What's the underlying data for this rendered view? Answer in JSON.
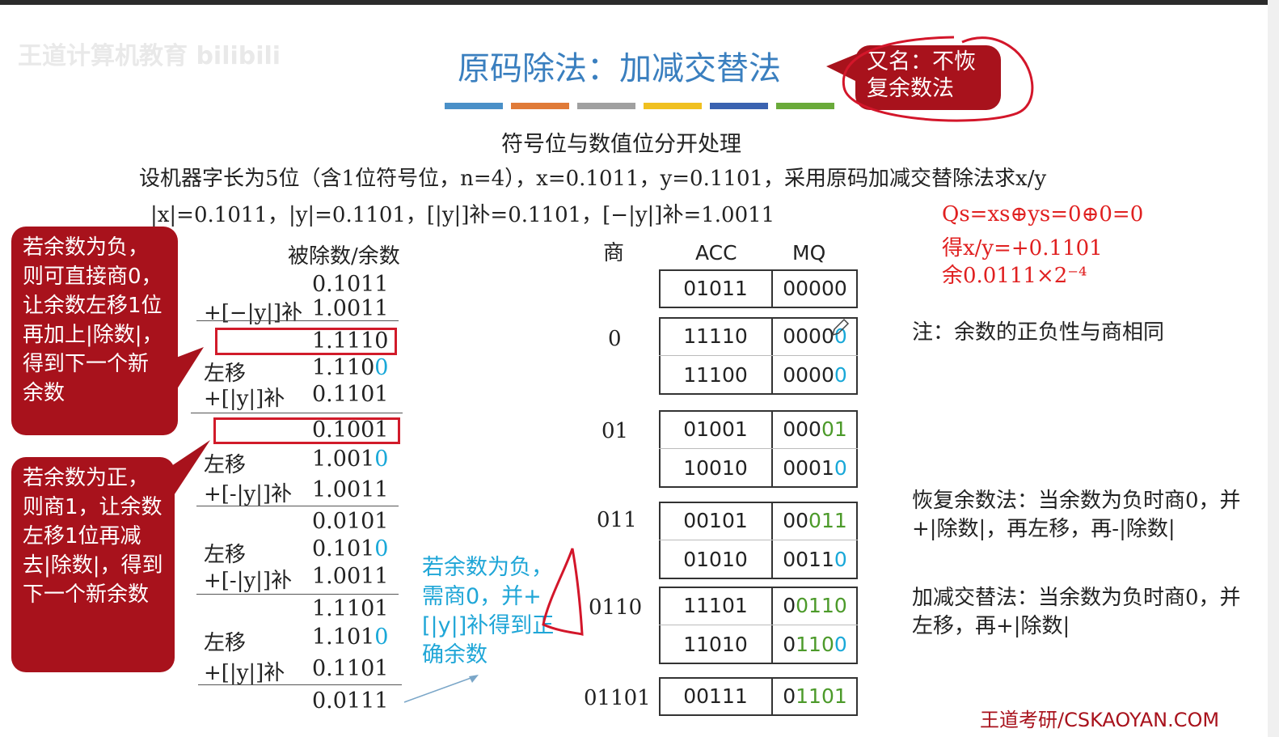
{
  "watermark": "王道计算机教育 bilibili",
  "title": "原码除法：加减交替法",
  "alias_bubble": "又名：不恢复余数法",
  "color_bar": [
    "#4a90c8",
    "#e07a37",
    "#a0a0a0",
    "#f0c020",
    "#3a62b0",
    "#6aaa3a"
  ],
  "subtitle": "符号位与数值位分开处理",
  "problem": "设机器字长为5位（含1位符号位，n=4），x=0.1011，y=0.1101，采用原码加减交替除法求x/y",
  "values_line": "|x|=0.1011，|y|=0.1101，[|y|]补=0.1101，[−|y|]补=1.0011",
  "result": {
    "line1": "Qs=xs⊕ys=0⊕0=0",
    "line2": "得x/y=+0.1101",
    "line3": "余0.0111×2⁻⁴"
  },
  "bubble_negative": "若余数为负，则可直接商0，让余数左移1位再加上|除数|，得到下一个新余数",
  "bubble_positive": "若余数为正，则商1，让余数左移1位再减去|除数|，得到下一个新余数",
  "col_headers": {
    "dividend": "被除数/余数",
    "quotient": "商",
    "acc": "ACC",
    "mq": "MQ"
  },
  "steps": [
    {
      "label": "",
      "value": "0.1011"
    },
    {
      "label": "+[−|y|]补",
      "value": "1.0011"
    },
    {
      "label": "",
      "value": "1.1110"
    },
    {
      "label": "左移",
      "value": "1.1100"
    },
    {
      "label": "+[|y|]补",
      "value": "0.1101"
    },
    {
      "label": "",
      "value": "0.1001"
    },
    {
      "label": "左移",
      "value": "1.0010"
    },
    {
      "label": "+[-|y|]补",
      "value": "1.0011"
    },
    {
      "label": "",
      "value": "0.0101"
    },
    {
      "label": "左移",
      "value": "0.1010"
    },
    {
      "label": "+[-|y|]补",
      "value": "1.0011"
    },
    {
      "label": "",
      "value": "1.1101"
    },
    {
      "label": "左移",
      "value": "1.1010"
    },
    {
      "label": "+[|y|]补",
      "value": "0.1101"
    },
    {
      "label": "",
      "value": "0.0111"
    }
  ],
  "quotients": [
    "0",
    "01",
    "011",
    "0110",
    "01101"
  ],
  "registers": [
    {
      "acc": "01011",
      "mq": "00000"
    },
    {
      "acc": "11110",
      "mq": "00000"
    },
    {
      "acc": "11100",
      "mq": "00000"
    },
    {
      "acc": "01001",
      "mq": "00001"
    },
    {
      "acc": "10010",
      "mq": "00010"
    },
    {
      "acc": "00101",
      "mq": "00011"
    },
    {
      "acc": "01010",
      "mq": "00110"
    },
    {
      "acc": "11101",
      "mq": "00110"
    },
    {
      "acc": "11010",
      "mq": "01100"
    },
    {
      "acc": "00111",
      "mq": "01101"
    }
  ],
  "cyan_note": "若余数为负，需商0，并+[|y|]补得到正确余数",
  "note_sign": "注：余数的正负性与商相同",
  "note_restore": "恢复余数法：当余数为负时商0，并+|除数|，再左移，再-|除数|",
  "note_alternate": "加减交替法：当余数为负时商0，并左移，再+|除数|",
  "footer": "王道考研/CSKAOYAN.COM"
}
